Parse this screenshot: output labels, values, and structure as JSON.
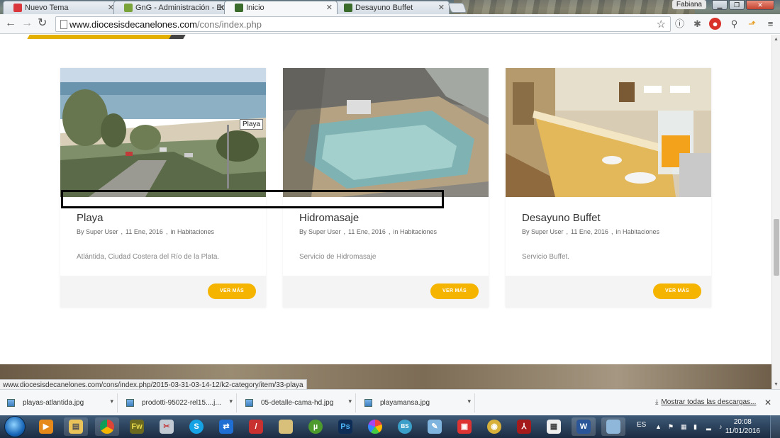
{
  "browser": {
    "tabs": [
      {
        "title": "Nuevo Tema",
        "favicon_color": "#d9373b",
        "active": false
      },
      {
        "title": "GnG - Administración - Ed",
        "favicon_color": "#7aa33a",
        "active": false
      },
      {
        "title": "Inicio",
        "favicon_color": "#3a6b2b",
        "active": true
      },
      {
        "title": "Desayuno Buffet",
        "favicon_color": "#3a6b2b",
        "active": false
      }
    ],
    "user": "Fabiana",
    "url_host": "www.diocesisdecanelones.com",
    "url_path": "/cons/index.php",
    "status_url": "www.diocesisdecanelones.com/cons/index.php/2015-03-31-03-14-12/k2-category/item/33-playa"
  },
  "cards": [
    {
      "title": "Playa",
      "author": "By Super User",
      "date": "11 Ene, 2016",
      "category": "in Habitaciones",
      "description": "Atlántida, Ciudad Costera del Río de la Plata.",
      "button": "VER MÁS",
      "tooltip": "Playa"
    },
    {
      "title": "Hidromasaje",
      "author": "By Super User",
      "date": "11 Ene, 2016",
      "category": "in Habitaciones",
      "description": "Servicio de Hidromasaje",
      "button": "VER MÁS"
    },
    {
      "title": "Desayuno Buffet",
      "author": "By Super User",
      "date": "11 Ene, 2016",
      "category": "in Habitaciones",
      "description": "Servicio Buffet.",
      "button": "VER MÁS"
    }
  ],
  "downloads": {
    "items": [
      "playas-atlantida.jpg",
      "prodotti-95022-rel15....j...",
      "05-detalle-cama-hd.jpg",
      "playamansa.jpg"
    ],
    "show_all": "Mostrar todas las descargas..."
  },
  "taskbar": {
    "language": "ES",
    "time": "20:08",
    "date": "11/01/2016"
  },
  "colors": {
    "accent": "#f5b400"
  }
}
